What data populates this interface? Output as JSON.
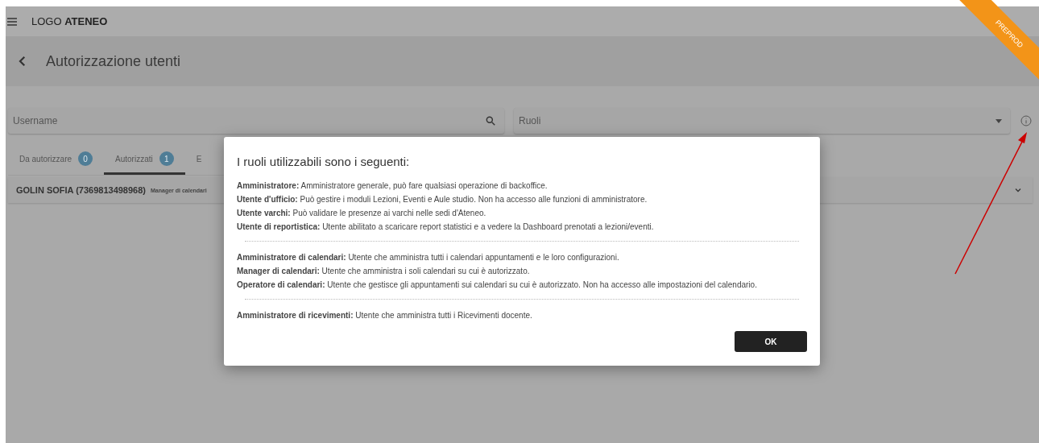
{
  "header": {
    "logo": "LOGO **ATENEO**",
    "ribbon": "PREPROD"
  },
  "page_title": "Autorizzazione utenti",
  "filters": {
    "username": {
      "placeholder": "Username"
    },
    "roles": {
      "placeholder": "Ruoli"
    }
  },
  "tabs": [
    {
      "label": "Da autorizzare",
      "count": "0",
      "selected": false
    },
    {
      "label": "Autorizzati",
      "count": "1",
      "selected": true
    },
    {
      "label": "E",
      "selected": false
    }
  ],
  "rows": [
    {
      "name": "GOLIN SOFIA (7369813498968)",
      "role": "Manager di calendari"
    }
  ],
  "dialog": {
    "title": "I ruoli utilizzabili sono i seguenti:",
    "sections": [
      [
        {
          "role": "Amministratore:",
          "description": "Amministratore generale, può fare qualsiasi operazione di backoffice."
        },
        {
          "role": "Utente d'ufficio:",
          "description": "Può gestire i moduli Lezioni, Eventi e Aule studio. Non ha accesso alle funzioni di amministratore."
        },
        {
          "role": "Utente varchi:",
          "description": "Può validare le presenze ai varchi nelle sedi d'Ateneo."
        },
        {
          "role": "Utente di reportistica:",
          "description": "Utente abilitato a scaricare report statistici e a vedere la Dashboard prenotati a lezioni/eventi."
        }
      ],
      [
        {
          "role": "Amministratore di calendari:",
          "description": "Utente che amministra tutti i calendari appuntamenti e le loro configurazioni."
        },
        {
          "role": "Manager di calendari:",
          "description": "Utente che amministra i soli calendari su cui è autorizzato."
        },
        {
          "role": "Operatore di calendari:",
          "description": "Utente che gestisce gli appuntamenti sui calendari su cui è autorizzato. Non ha accesso alle impostazioni del calendario."
        }
      ],
      [
        {
          "role": "Amministratore di ricevimenti:",
          "description": "Utente che amministra tutti i Ricevimenti docente."
        }
      ]
    ],
    "button": "OK"
  }
}
